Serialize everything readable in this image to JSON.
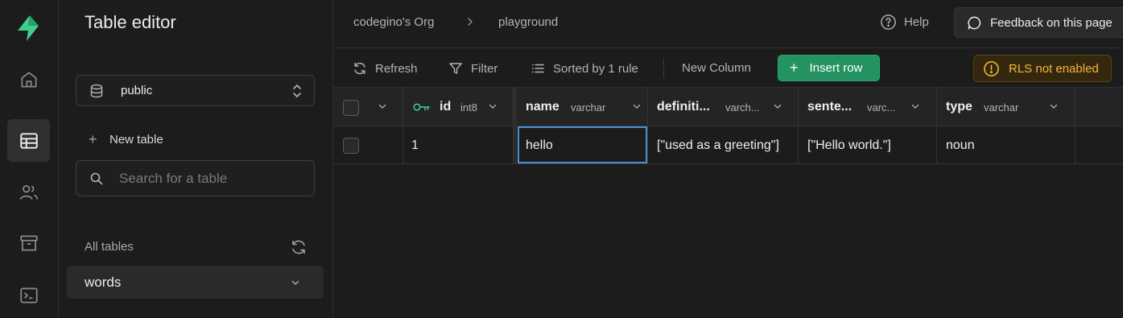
{
  "nav": {
    "items": [
      "home",
      "table-editor",
      "authentication",
      "storage",
      "sql-editor"
    ],
    "active": "table-editor"
  },
  "sidebar": {
    "title": "Table editor",
    "schema": "public",
    "new_table_label": "New table",
    "search_placeholder": "Search for a table",
    "all_tables_label": "All tables",
    "tables": [
      "words"
    ]
  },
  "header": {
    "org": "codegino's Org",
    "project": "playground",
    "help_label": "Help",
    "feedback_label": "Feedback on this page"
  },
  "toolbar": {
    "refresh_label": "Refresh",
    "filter_label": "Filter",
    "sort_label": "Sorted by 1 rule",
    "new_column_label": "New Column",
    "insert_row_label": "Insert row",
    "rls_label": "RLS not enabled"
  },
  "grid": {
    "columns": [
      {
        "name": "id",
        "type": "int8",
        "primary_key": true
      },
      {
        "name": "name",
        "type": "varchar"
      },
      {
        "name": "definiti...",
        "type": "varch..."
      },
      {
        "name": "sente...",
        "type": "varc..."
      },
      {
        "name": "type",
        "type": "varchar"
      }
    ],
    "rows": [
      {
        "id": "1",
        "name": "hello",
        "definition": "[\"used as a greeting\"]",
        "sentence": "[\"Hello world.\"]",
        "type": "noun"
      }
    ]
  },
  "colors": {
    "brand": "#3ecf8e",
    "insert_button": "#249361",
    "warning": "#f5b73a",
    "selection": "#4b8fd4"
  }
}
